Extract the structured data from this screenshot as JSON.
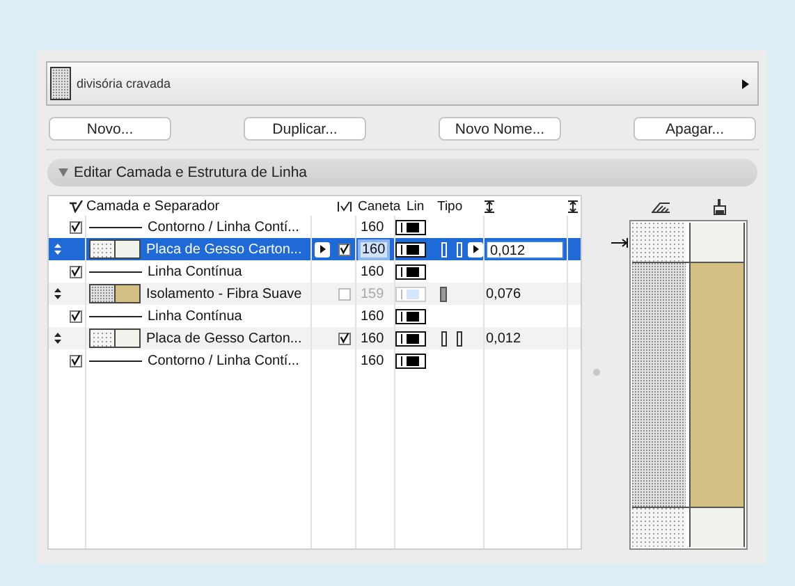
{
  "selector": {
    "name": "divisória cravada"
  },
  "buttons": [
    "Novo...",
    "Duplicar...",
    "Novo Nome...",
    "Apagar..."
  ],
  "section": {
    "title": "Editar Camada e Estrutura de Linha",
    "expanded": true
  },
  "table": {
    "columns": [
      "Camada e Separador",
      "Caneta",
      "Lin",
      "Tipo"
    ],
    "rows": [
      {
        "kind": "line",
        "selected": false,
        "checked": true,
        "name": "Contorno / Linha Contí...",
        "pen": "160"
      },
      {
        "kind": "layer",
        "selected": true,
        "dense_hatch": false,
        "color": "#f0f3ec",
        "name": "Placa de Gesso Carton...",
        "core": true,
        "disabled": false,
        "pen": "160",
        "thickness": "0,012"
      },
      {
        "kind": "line",
        "selected": false,
        "checked": true,
        "name": "Linha Contínua",
        "pen": "160"
      },
      {
        "kind": "layer",
        "selected": false,
        "dense_hatch": true,
        "color": "#d4bf82",
        "name": "Isolamento - Fibra Suave",
        "core": false,
        "disabled": true,
        "pen": "159",
        "thickness": "0,076"
      },
      {
        "kind": "line",
        "selected": false,
        "checked": true,
        "name": "Linha Contínua",
        "pen": "160"
      },
      {
        "kind": "layer",
        "selected": false,
        "dense_hatch": false,
        "color": "#f0f3ec",
        "name": "Placa de Gesso Carton...",
        "core": true,
        "disabled": false,
        "pen": "160",
        "thickness": "0,012"
      },
      {
        "kind": "line",
        "selected": false,
        "checked": true,
        "name": "Contorno / Linha Contí...",
        "pen": "160"
      }
    ]
  }
}
